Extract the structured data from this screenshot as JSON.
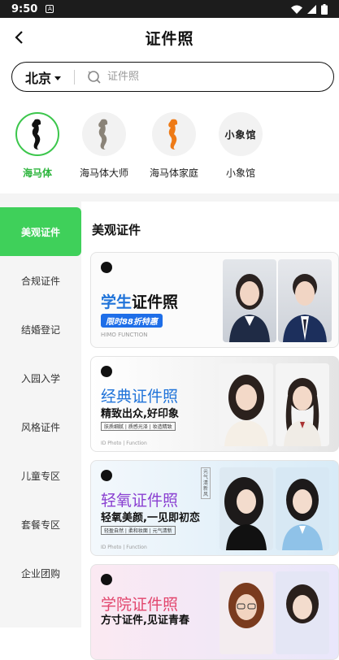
{
  "status": {
    "time": "9:50",
    "badge": "A"
  },
  "nav": {
    "title": "证件照"
  },
  "search": {
    "city": "北京",
    "placeholder": "证件照"
  },
  "brands": [
    {
      "label": "海马体",
      "active": true
    },
    {
      "label": "海马体大师",
      "active": false
    },
    {
      "label": "海马体家庭",
      "active": false
    },
    {
      "label": "小象馆",
      "active": false,
      "logo_text": "小象馆"
    }
  ],
  "sidebar": {
    "items": [
      {
        "label": "美观证件"
      },
      {
        "label": "合规证件"
      },
      {
        "label": "结婚登记"
      },
      {
        "label": "入园入学"
      },
      {
        "label": "风格证件"
      },
      {
        "label": "儿童专区"
      },
      {
        "label": "套餐专区"
      },
      {
        "label": "企业团购"
      }
    ]
  },
  "content": {
    "heading": "美观证件",
    "cards": [
      {
        "title_a": "学生",
        "title_b": "证件照",
        "tag": "限时88折特惠",
        "foot": "HIMO FUNCTION"
      },
      {
        "title": "经典证件照",
        "subtitle": "精致出众,好印象",
        "chips": "肤质细腻 | 质感光泽 | 妆造精致",
        "foot": "ID Photo | Function"
      },
      {
        "title": "轻氧证件照",
        "subtitle": "轻氧美颜,一见即初恋",
        "chips": "轻盈自然 | 柔和妆面 | 元气清新",
        "foot": "ID Photo | Function",
        "side_tag": "元气清新风"
      },
      {
        "title": "学院证件照",
        "subtitle": "方寸证件,见证青春"
      }
    ]
  },
  "colors": {
    "accent": "#3fd05a",
    "active_text": "#2cb53c"
  }
}
